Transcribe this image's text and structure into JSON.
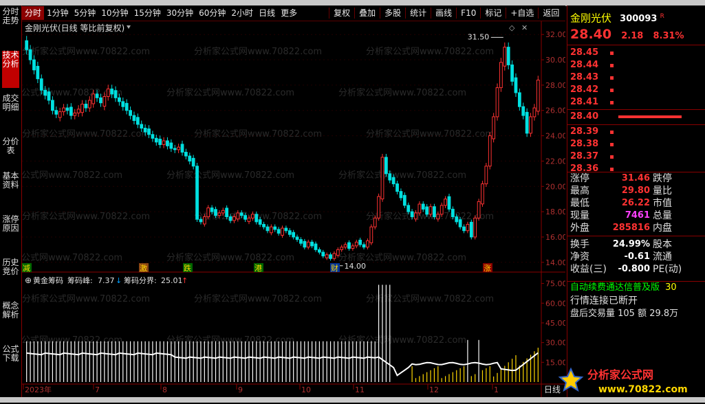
{
  "toolbar": {
    "periods": [
      "分时",
      "1分钟",
      "5分钟",
      "10分钟",
      "15分钟",
      "30分钟",
      "60分钟",
      "2小时",
      "日线",
      "更多"
    ],
    "active_period": "分时",
    "tools": [
      "复权",
      "叠加",
      "多股",
      "统计",
      "画线",
      "F10",
      "标记",
      "+自选",
      "返回"
    ]
  },
  "sidebar": {
    "tabs": [
      "分时走势",
      "技术分析",
      "成交明细",
      "分价表",
      "基本资料",
      "涨停原因",
      "历史竞价",
      "概念解析",
      "公式下载"
    ],
    "active": "技术分析"
  },
  "chart": {
    "title": "金刚光伏(日线 等比前复权)",
    "max_label": "31.50",
    "min_label": "14.00",
    "price_axis": [
      "32.00",
      "30.00",
      "28.00",
      "26.00",
      "24.00",
      "22.00",
      "20.00",
      "18.00",
      "16.00",
      "14.00"
    ],
    "markers": [
      "减",
      "激",
      "跌",
      "港",
      "财",
      "涨"
    ],
    "indicator": {
      "name": "黄金筹码",
      "peak_label": "筹码峰:",
      "peak_value": "7.37",
      "split_label": "筹码分界:",
      "split_value": "25.01",
      "axis": [
        "75.00",
        "60.00",
        "45.00",
        "30.00",
        "15.00"
      ]
    },
    "x_axis": [
      "2023年",
      "7",
      "8",
      "9",
      "10",
      "11",
      "12",
      "1"
    ],
    "period_label": "日线",
    "watermark": "分析家公式网www.70822.com"
  },
  "quote": {
    "name": "金刚光伏",
    "code": "300093",
    "r_mark": "R",
    "price": "28.40",
    "change": "2.18",
    "pct": "8.31%",
    "asks": [
      {
        "price": "28.45",
        "vol": "▪"
      },
      {
        "price": "28.44",
        "vol": "▪"
      },
      {
        "price": "28.43",
        "vol": "▪"
      },
      {
        "price": "28.42",
        "vol": "▪"
      },
      {
        "price": "28.41",
        "vol": "▪"
      }
    ],
    "last_trade": "28.40",
    "bids": [
      {
        "price": "28.39",
        "vol": "▪"
      },
      {
        "price": "28.38",
        "vol": "▪"
      },
      {
        "price": "28.37",
        "vol": "▪"
      },
      {
        "price": "28.36",
        "vol": "▪"
      }
    ],
    "stats": [
      {
        "l1": "涨停",
        "v1": "31.46",
        "l2": "跌停"
      },
      {
        "l1": "最高",
        "v1": "29.80",
        "l2": "量比"
      },
      {
        "l1": "最低",
        "v1": "26.22",
        "l2": "市值"
      },
      {
        "l1": "现量",
        "v1": "7461",
        "l2": "总量"
      },
      {
        "l1": "外盘",
        "v1": "285816",
        "l2": "内盘"
      }
    ],
    "stats2": [
      {
        "l1": "换手",
        "v1": "24.99%",
        "l2": "股本"
      },
      {
        "l1": "净资",
        "v1": "-0.61",
        "l2": "流通"
      },
      {
        "l1": "收益(三)",
        "v1": "-0.800",
        "l2": "PE(动)"
      }
    ],
    "notice1": "自动续费通达信普及版",
    "notice1_tail": "30",
    "notice2": "行情连接已断开",
    "after_hours": "盘后交易量 105 额 29.8万"
  },
  "logo": {
    "name": "分析家公式网",
    "url": "www.70822.com"
  },
  "colors": {
    "up": "#ff3232",
    "down": "#00e0e0",
    "bg": "#000000",
    "grid": "#8b0000"
  },
  "chart_data": {
    "type": "candlestick",
    "title": "金刚光伏(日线 等比前复权)",
    "ylim": [
      13.5,
      32.5
    ],
    "max": 31.5,
    "min": 14.0,
    "series": [
      {
        "name": "close",
        "values": [
          30.8,
          30.0,
          29.2,
          28.5,
          27.6,
          27.2,
          26.8,
          26.0,
          25.7,
          25.9,
          26.2,
          26.0,
          25.6,
          25.8,
          26.1,
          26.5,
          26.2,
          26.8,
          27.3,
          27.0,
          26.6,
          27.1,
          27.7,
          27.3,
          27.0,
          26.7,
          26.3,
          26.0,
          25.6,
          25.2,
          24.9,
          24.6,
          24.3,
          24.1,
          23.8,
          23.5,
          23.3,
          23.6,
          23.2,
          23.0,
          22.9,
          23.1,
          22.7,
          22.4,
          22.0,
          21.6,
          17.4,
          17.2,
          17.6,
          18.3,
          18.0,
          17.7,
          17.9,
          18.1,
          17.6,
          17.3,
          17.6,
          17.9,
          17.7,
          17.4,
          17.5,
          17.8,
          17.2,
          17.0,
          16.8,
          16.5,
          16.8,
          16.6,
          16.3,
          16.7,
          16.5,
          16.2,
          16.0,
          15.8,
          15.5,
          15.2,
          15.6,
          15.3,
          15.0,
          14.8,
          14.5,
          14.6,
          14.3,
          14.7,
          15.0,
          15.2,
          15.4,
          15.1,
          15.3,
          15.6,
          15.4,
          15.2,
          15.7,
          16.8,
          17.5,
          19.2,
          22.3,
          21.0,
          20.5,
          20.2,
          19.6,
          19.1,
          18.5,
          18.0,
          17.6,
          17.9,
          18.6,
          18.2,
          17.8,
          18.4,
          17.6,
          17.8,
          18.5,
          19.0,
          18.2,
          17.6,
          17.2,
          16.8,
          16.5,
          17.0,
          16.0,
          17.5,
          18.8,
          20.2,
          21.6,
          24.0,
          25.5,
          27.8,
          29.8,
          31.0,
          29.6,
          28.3,
          27.4,
          26.3,
          25.6,
          24.2,
          25.5,
          26.2,
          28.4
        ]
      }
    ],
    "indicator": {
      "name": "黄金筹码",
      "peak": 7.37,
      "split": 25.01,
      "ylim": [
        0,
        80
      ]
    }
  }
}
